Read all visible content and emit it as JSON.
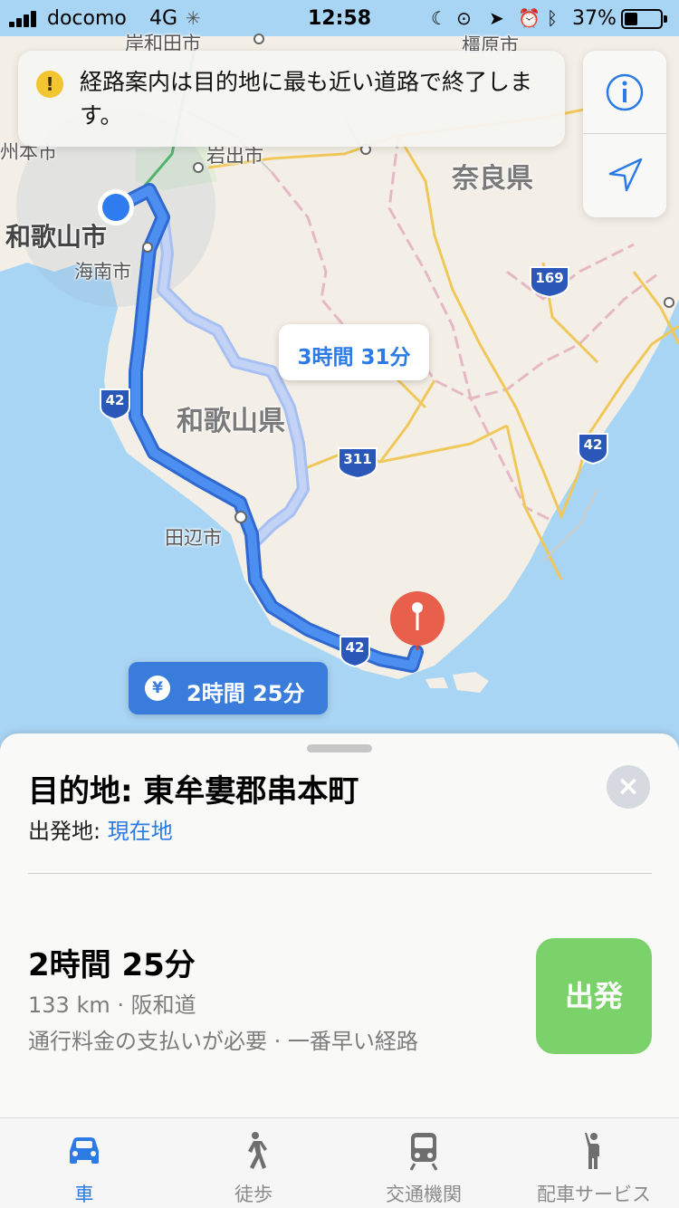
{
  "status_bar": {
    "carrier": "docomo",
    "network": "4G",
    "time": "12:58",
    "battery": "37%"
  },
  "notice": {
    "icon": "exclamation-icon",
    "text": "経路案内は目的地に最も近い道路で終了します。"
  },
  "map": {
    "labels": {
      "prefecture_nara": "奈良県",
      "prefecture_wakayama": "和歌山県",
      "city_wakayama": "和歌山市",
      "city_kainan": "海南市",
      "city_tanabe": "田辺市",
      "city_iwade": "岩出市",
      "city_kishiwada": "岸和田市",
      "city_kashihara": "橿原市",
      "city_izumi": "州本市"
    },
    "routes": {
      "shield_42": "42",
      "shield_169": "169",
      "shield_311": "311"
    },
    "alt_route_time": "3時間 31分",
    "main_route_time": "2時間 25分",
    "toll_icon": "¥"
  },
  "controls": {
    "info_icon": "info-icon",
    "location_icon": "location-arrow-icon"
  },
  "sheet": {
    "destination": "目的地: 東牟婁郡串本町",
    "origin_label": "出発地:",
    "origin_value": "現在地",
    "duration": "2時間 25分",
    "distance_route": "133 km · 阪和道",
    "notes": "通行料金の支払いが必要 · 一番早い経路",
    "go_button": "出発",
    "close_icon": "×"
  },
  "tabs": [
    {
      "label": "車",
      "icon": "car-icon",
      "active": true
    },
    {
      "label": "徒歩",
      "icon": "walk-icon",
      "active": false
    },
    {
      "label": "交通機関",
      "icon": "train-icon",
      "active": false
    },
    {
      "label": "配車サービス",
      "icon": "ride-icon",
      "active": false
    }
  ],
  "colors": {
    "accent": "#2c7be5",
    "route": "#3a7cdc",
    "go": "#7cd26a",
    "water": "#a8d4f3",
    "land": "#f2efe6"
  }
}
